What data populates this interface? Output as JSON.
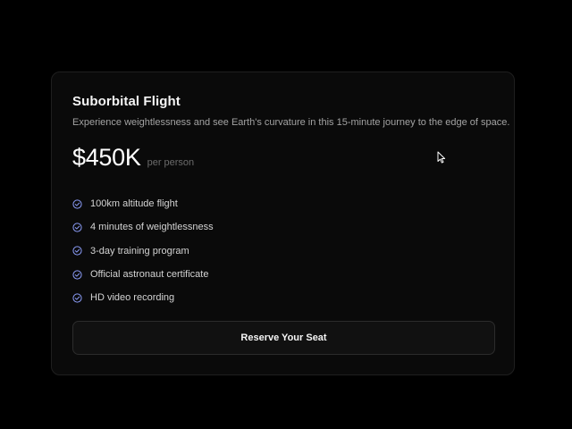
{
  "plan": {
    "title": "Suborbital Flight",
    "description": "Experience weightlessness and see Earth's curvature in this 15-minute journey to the edge of space.",
    "price": "$450K",
    "price_unit": "per person",
    "features": [
      {
        "label": "100km altitude flight",
        "icon": "check-circle-icon"
      },
      {
        "label": "4 minutes of weightlessness",
        "icon": "check-circle-icon"
      },
      {
        "label": "3-day training program",
        "icon": "check-circle-icon"
      },
      {
        "label": "Official astronaut certificate",
        "icon": "check-circle-icon"
      },
      {
        "label": "HD video recording",
        "icon": "check-circle-icon"
      }
    ],
    "cta_label": "Reserve Your Seat"
  },
  "colors": {
    "background": "#000000",
    "card": "#0a0a0a",
    "check_accent": "#8b9cf7"
  }
}
